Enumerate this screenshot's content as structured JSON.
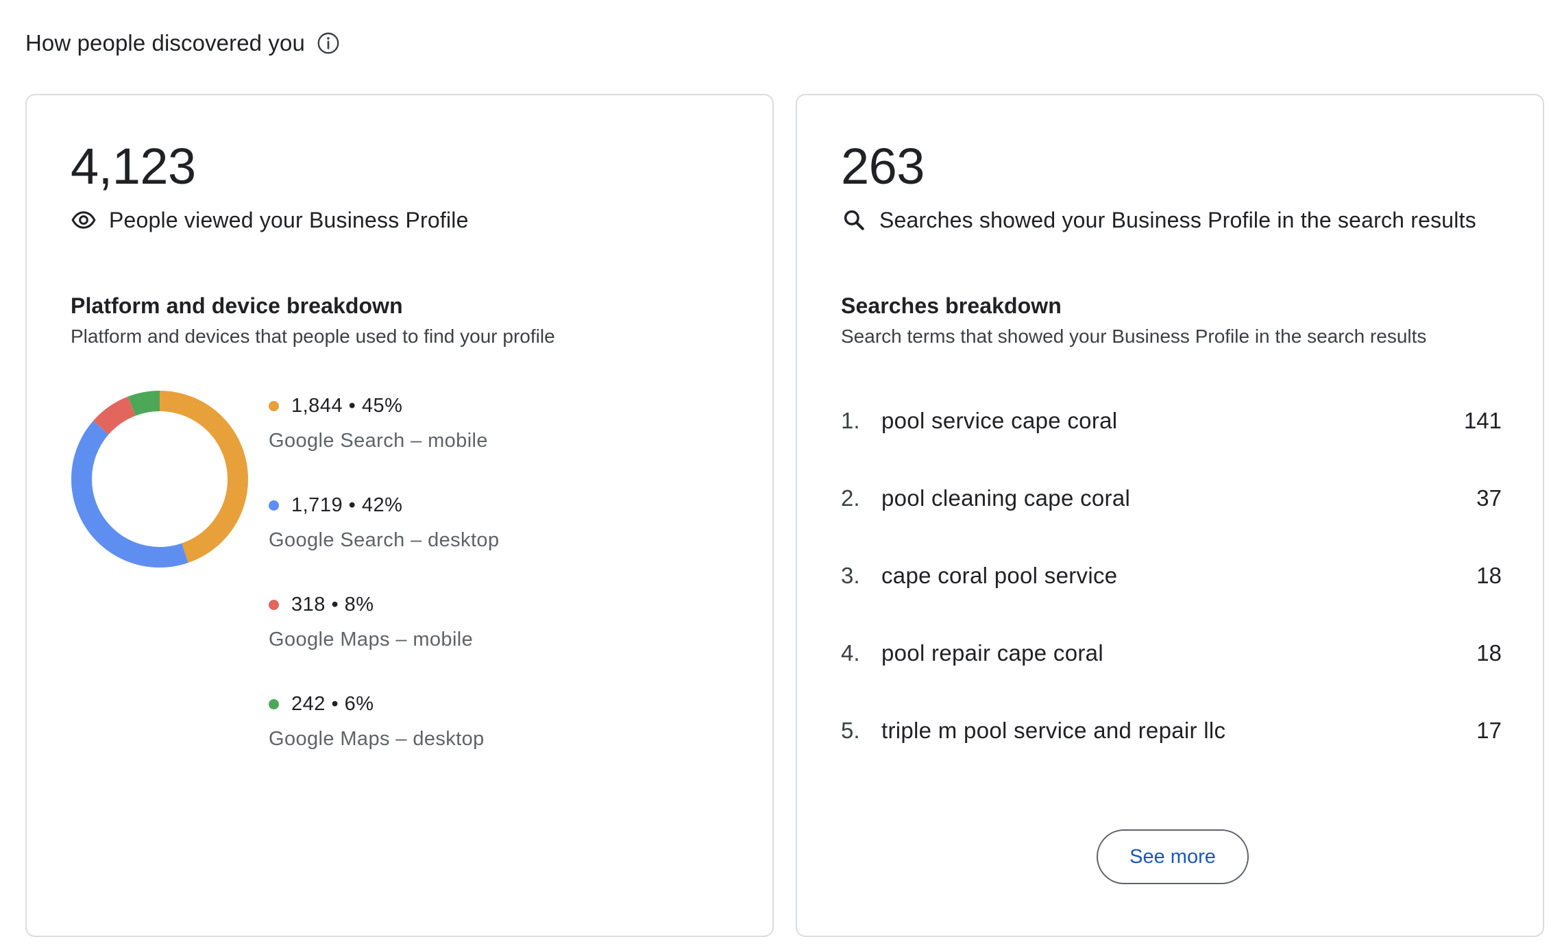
{
  "header": {
    "title": "How people discovered you",
    "info_icon": "info-circle-icon"
  },
  "views_card": {
    "total": "4,123",
    "label": "People viewed your Business Profile",
    "icon": "eye-icon",
    "breakdown_title": "Platform and device breakdown",
    "breakdown_desc": "Platform and devices that people used to find your profile",
    "legend": [
      {
        "value": "1,844 • 45%",
        "label": "Google Search – mobile",
        "color": "#e8a03a"
      },
      {
        "value": "1,719 • 42%",
        "label": "Google Search – desktop",
        "color": "#5e8ff0"
      },
      {
        "value": "318 • 8%",
        "label": "Google Maps – mobile",
        "color": "#e3665e"
      },
      {
        "value": "242 • 6%",
        "label": "Google Maps – desktop",
        "color": "#4ca858"
      }
    ]
  },
  "searches_card": {
    "total": "263",
    "label": "Searches showed your Business Profile in the search results",
    "icon": "search-icon",
    "breakdown_title": "Searches breakdown",
    "breakdown_desc": "Search terms that showed your Business Profile in the search results",
    "terms": [
      {
        "rank": "1.",
        "term": "pool service cape coral",
        "count": "141"
      },
      {
        "rank": "2.",
        "term": "pool cleaning cape coral",
        "count": "37"
      },
      {
        "rank": "3.",
        "term": "cape coral pool service",
        "count": "18"
      },
      {
        "rank": "4.",
        "term": "pool repair cape coral",
        "count": "18"
      },
      {
        "rank": "5.",
        "term": "triple m pool service and repair llc",
        "count": "17"
      }
    ],
    "see_more_label": "See more"
  },
  "chart_data": {
    "type": "pie",
    "categories": [
      "Google Search – mobile",
      "Google Search – desktop",
      "Google Maps – mobile",
      "Google Maps – desktop"
    ],
    "values": [
      1844,
      1719,
      318,
      242
    ],
    "colors": [
      "#e8a03a",
      "#5e8ff0",
      "#e3665e",
      "#4ca858"
    ]
  }
}
